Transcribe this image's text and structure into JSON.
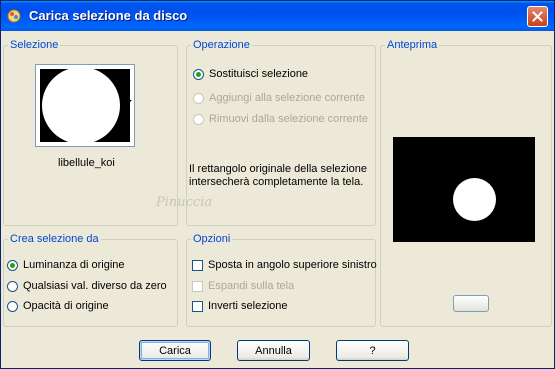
{
  "window": {
    "title": "Carica selezione da disco"
  },
  "selezione": {
    "legend": "Selezione",
    "thumbnail_name": "libellule_koi"
  },
  "operazione": {
    "legend": "Operazione",
    "options": [
      {
        "label": "Sostituisci selezione",
        "checked": true,
        "enabled": true
      },
      {
        "label": "Aggiungi alla selezione corrente",
        "checked": false,
        "enabled": false
      },
      {
        "label": "Rimuovi dalla selezione corrente",
        "checked": false,
        "enabled": false
      }
    ],
    "description_line1": "Il rettangolo originale della selezione",
    "description_line2": "intersecherà completamente la tela."
  },
  "anteprima": {
    "legend": "Anteprima"
  },
  "crea": {
    "legend": "Crea selezione da",
    "options": [
      {
        "label": "Luminanza di origine",
        "checked": true
      },
      {
        "label": "Qualsiasi val. diverso da zero",
        "checked": false
      },
      {
        "label": "Opacità di origine",
        "checked": false
      }
    ]
  },
  "opzioni": {
    "legend": "Opzioni",
    "checkboxes": [
      {
        "label": "Sposta in angolo superiore sinistro",
        "checked": false,
        "enabled": true
      },
      {
        "label": "Espandi sulla tela",
        "checked": false,
        "enabled": false
      },
      {
        "label": "Inverti selezione",
        "checked": false,
        "enabled": true
      }
    ]
  },
  "buttons": {
    "load": "Carica",
    "cancel": "Annulla",
    "help": "?"
  },
  "watermark": "Pinuccia",
  "colors": {
    "titlebar": "#0058E6",
    "dialog_bg": "#ECE9D8",
    "legend_text": "#0046D5",
    "radio_selected": "#21A121"
  },
  "icons": {
    "app": "app-icon",
    "close": "close-icon",
    "dropdown": "dropdown-arrow-icon"
  }
}
